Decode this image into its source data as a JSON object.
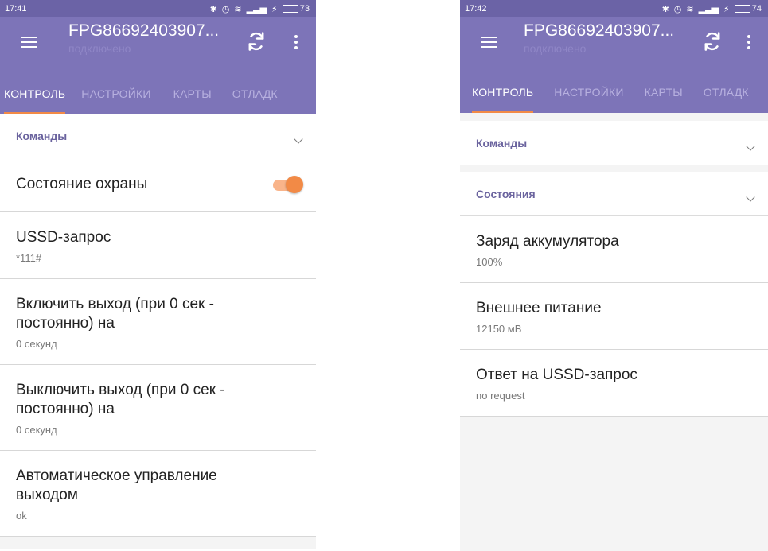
{
  "colors": {
    "primary": "#7d74b8",
    "status_bar": "#6b63a6",
    "accent": "#f28a46",
    "section_header": "#6a639e"
  },
  "left": {
    "status": {
      "time": "17:41",
      "battery": "73"
    },
    "appbar": {
      "title": "FPG86692403907...",
      "subtitle": "подключено"
    },
    "tabs": [
      "КОНТРОЛЬ",
      "НАСТРОЙКИ",
      "КАРТЫ",
      "ОТЛАДК"
    ],
    "section": "Команды",
    "items": [
      {
        "title": "Состояние охраны",
        "summary": ""
      },
      {
        "title": "USSD-запрос",
        "summary": "*111#"
      },
      {
        "title": "Включить выход (при 0 сек - постоянно) на",
        "summary": "0 секунд"
      },
      {
        "title": "Выключить выход (при 0 сек - постоянно) на",
        "summary": "0 секунд"
      },
      {
        "title": "Автоматическое управление выходом",
        "summary": "ok"
      }
    ],
    "toggle_on": true
  },
  "right": {
    "status": {
      "time": "17:42",
      "battery": "74"
    },
    "appbar": {
      "title": "FPG86692403907...",
      "subtitle": "подключено"
    },
    "tabs": [
      "КОНТРОЛЬ",
      "НАСТРОЙКИ",
      "КАРТЫ",
      "ОТЛАДК"
    ],
    "sections": [
      "Команды",
      "Состояния"
    ],
    "items": [
      {
        "title": "Заряд аккумулятора",
        "summary": "100%"
      },
      {
        "title": "Внешнее питание",
        "summary": "12150 мВ"
      },
      {
        "title": "Ответ на USSD-запрос",
        "summary": "no request"
      }
    ]
  }
}
